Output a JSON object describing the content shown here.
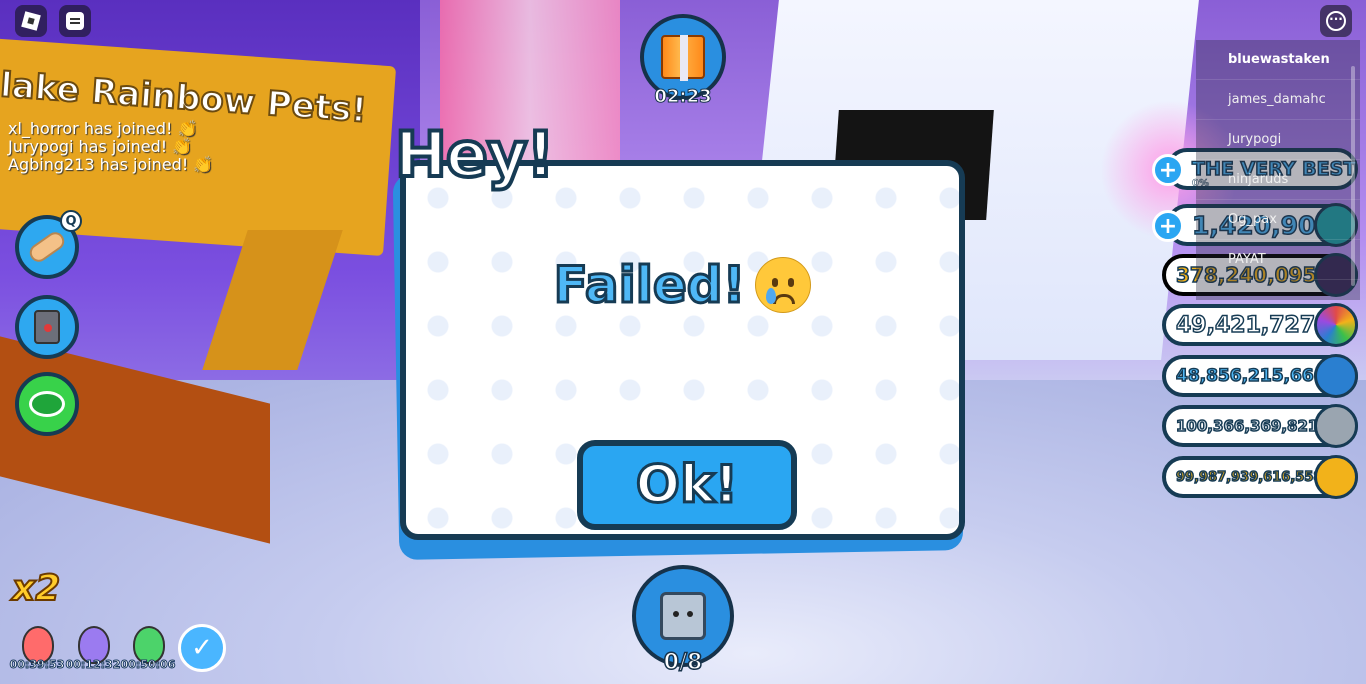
{
  "sign": {
    "text": "lake Rainbow Pets!"
  },
  "chat": [
    {
      "text": "xl_horror has joined!",
      "emoji": "👏"
    },
    {
      "text": "Jurypogi has joined!",
      "emoji": "👏"
    },
    {
      "text": "Agbing213 has joined!",
      "emoji": "👏"
    }
  ],
  "hotkey": {
    "label": "Q"
  },
  "gift": {
    "timer": "02:23"
  },
  "modal": {
    "title": "Hey!",
    "message": "Failed!",
    "button_label": "Ok!"
  },
  "pets": {
    "count": "0/8"
  },
  "boost": {
    "multiplier": "x2"
  },
  "potions": [
    {
      "timer": "00:39:53",
      "color": "#ff6b6b"
    },
    {
      "timer": "00:12:32",
      "color": "#9b7bf0"
    },
    {
      "timer": "00:50:06",
      "color": "#4cd36a"
    }
  ],
  "currencies": [
    {
      "amount": "THE VERY BEST",
      "sub": "0%",
      "icon": "rank-bar-icon",
      "color": "#4fb8f6",
      "plus": true
    },
    {
      "amount": "1,420,902",
      "icon": "diamond-icon",
      "color": "#1fa3a8",
      "plus": true
    },
    {
      "amount": "378,240,095",
      "icon": "dark-coin-icon",
      "color": "#3a2a5a",
      "plus": false
    },
    {
      "amount": "49,421,727",
      "icon": "rainbow-coin-icon",
      "color": "#e04a8a",
      "plus": false
    },
    {
      "amount": "48,856,215,666",
      "icon": "blue-paw-coin-icon",
      "color": "#2a7fd0",
      "plus": false
    },
    {
      "amount": "100,366,369,821",
      "icon": "silver-paw-coin-icon",
      "color": "#9aa5b0",
      "plus": false
    },
    {
      "amount": "99,987,939,616,558",
      "icon": "gold-coin-icon",
      "color": "#f2b21a",
      "plus": false
    }
  ],
  "players": [
    {
      "name": "bluewastaken"
    },
    {
      "name": "james_damahc"
    },
    {
      "name": "Jurypogi"
    },
    {
      "name": "ninjaruds"
    },
    {
      "name": "Og_pax"
    },
    {
      "name": "PAYAT"
    }
  ]
}
